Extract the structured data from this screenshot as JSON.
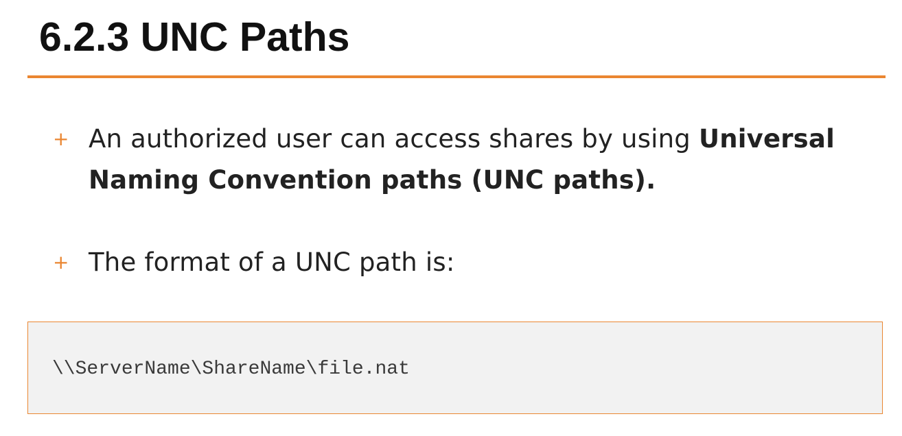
{
  "heading": {
    "title": "6.2.3 UNC Paths"
  },
  "bullets": [
    {
      "marker": "+",
      "text": "An authorized user can access shares by using ",
      "bold": "Universal Naming Convention paths (UNC paths)."
    },
    {
      "marker": "+",
      "text": "The format of a UNC path is:"
    }
  ],
  "code_block": {
    "code": "\\\\ServerName\\ShareName\\file.nat"
  },
  "colors": {
    "accent": "#ea8631",
    "code_background": "#f2f2f2",
    "text": "#222222"
  }
}
